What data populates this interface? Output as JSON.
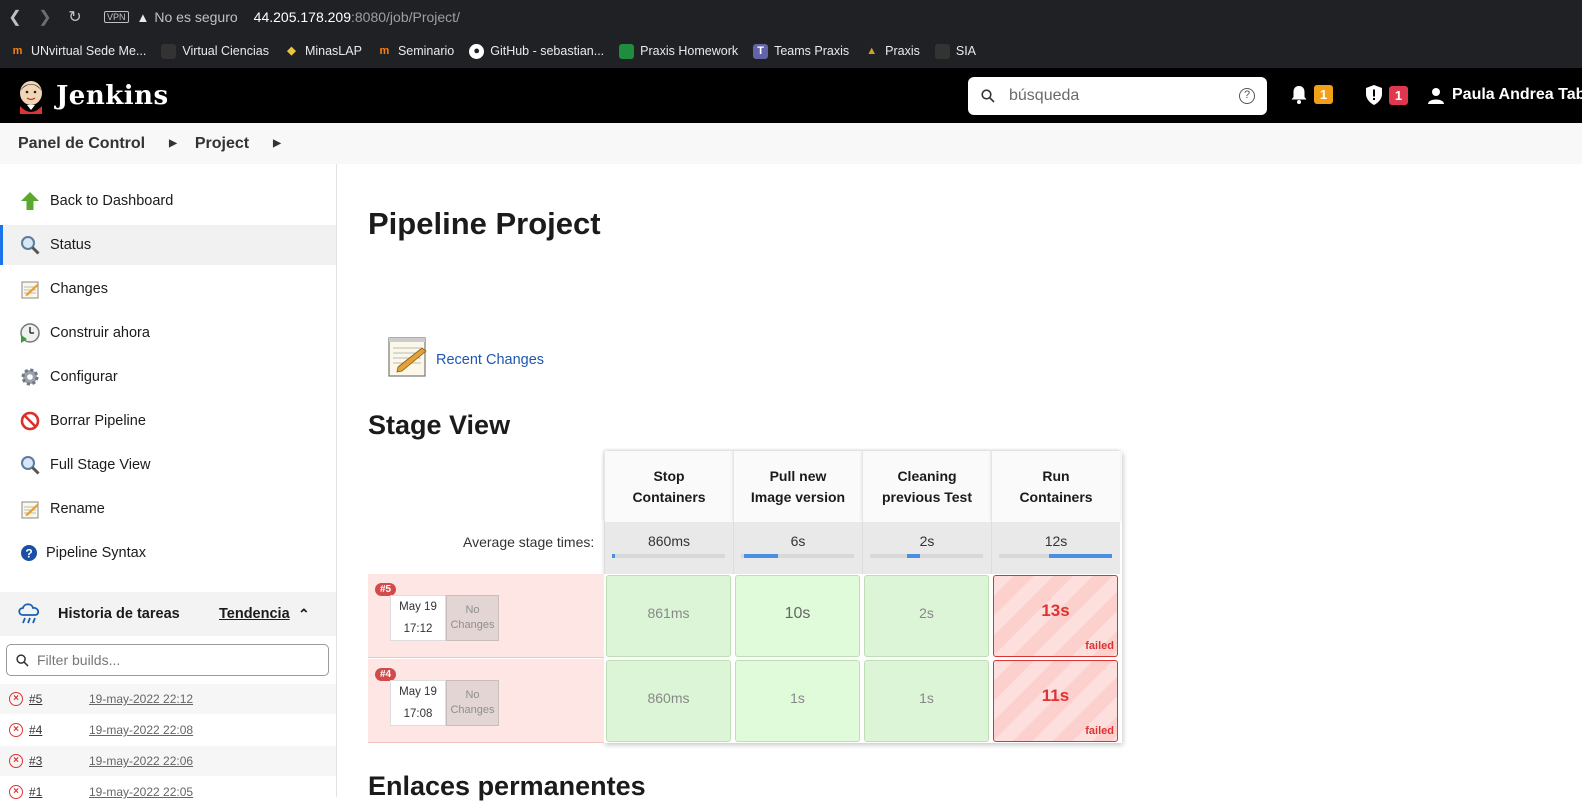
{
  "browser": {
    "vpn_label": "VPN",
    "security_text": "No es seguro",
    "url_host": "44.205.178.209",
    "url_rest": ":8080/job/Project/",
    "bookmarks": [
      {
        "label": "UNvirtual Sede Me...",
        "icon": "moodle-icon",
        "color": "#f98012"
      },
      {
        "label": "Virtual Ciencias",
        "icon": "page-icon",
        "color": "#333"
      },
      {
        "label": "MinasLAP",
        "icon": "minas-icon",
        "color": "#e8c547"
      },
      {
        "label": "Seminario",
        "icon": "moodle-icon",
        "color": "#f98012"
      },
      {
        "label": "GitHub - sebastian...",
        "icon": "github-icon",
        "color": "#fff"
      },
      {
        "label": "Praxis Homework",
        "icon": "classroom-icon",
        "color": "#1e8e3e"
      },
      {
        "label": "Teams Praxis",
        "icon": "teams-icon",
        "color": "#6264a7"
      },
      {
        "label": "Praxis",
        "icon": "praxis-icon",
        "color": "#c9a227"
      },
      {
        "label": "SIA",
        "icon": "page-icon",
        "color": "#333"
      }
    ]
  },
  "header": {
    "app_name": "Jenkins",
    "search_placeholder": "búsqueda",
    "notifications_count": "1",
    "security_count": "1",
    "user_name": "Paula Andrea Tab"
  },
  "breadcrumb": [
    "Panel de Control",
    "Project"
  ],
  "sidebar": {
    "items": [
      {
        "label": "Back to Dashboard",
        "icon": "arrow-up-icon"
      },
      {
        "label": "Status",
        "icon": "magnifier-icon"
      },
      {
        "label": "Changes",
        "icon": "notepad-icon"
      },
      {
        "label": "Construir ahora",
        "icon": "clock-play-icon"
      },
      {
        "label": "Configurar",
        "icon": "gear-icon"
      },
      {
        "label": "Borrar Pipeline",
        "icon": "no-entry-icon"
      },
      {
        "label": "Full Stage View",
        "icon": "magnifier-icon"
      },
      {
        "label": "Rename",
        "icon": "notepad-icon"
      },
      {
        "label": "Pipeline Syntax",
        "icon": "help-icon"
      }
    ],
    "history_title": "Historia de tareas",
    "trend_label": "Tendencia",
    "filter_placeholder": "Filter builds...",
    "builds": [
      {
        "num": "#5",
        "date": "19-may-2022 22:12"
      },
      {
        "num": "#4",
        "date": "19-may-2022 22:08"
      },
      {
        "num": "#3",
        "date": "19-may-2022 22:06"
      },
      {
        "num": "#1",
        "date": "19-may-2022 22:05"
      }
    ]
  },
  "main": {
    "title": "Pipeline Project",
    "recent_changes": "Recent Changes",
    "stage_view_title": "Stage View",
    "permalinks_title": "Enlaces permanentes",
    "avg_label": "Average stage times:",
    "stages": [
      {
        "name_line1": "Stop",
        "name_line2": "Containers",
        "avg": "860ms",
        "avg_fill_start": 0.0,
        "avg_fill_end": 0.03
      },
      {
        "name_line1": "Pull new",
        "name_line2": "Image version",
        "avg": "6s",
        "avg_fill_start": 0.03,
        "avg_fill_end": 0.33
      },
      {
        "name_line1": "Cleaning",
        "name_line2": "previous Test",
        "avg": "2s",
        "avg_fill_start": 0.33,
        "avg_fill_end": 0.44
      },
      {
        "name_line1": "Run",
        "name_line2": "Containers",
        "avg": "12s",
        "avg_fill_start": 0.44,
        "avg_fill_end": 1.0
      }
    ],
    "runs": [
      {
        "tag": "#5",
        "date": "May 19",
        "time": "17:12",
        "changes_line1": "No",
        "changes_line2": "Changes",
        "cells": [
          {
            "value": "861ms",
            "status": "ok"
          },
          {
            "value": "10s",
            "status": "ok"
          },
          {
            "value": "2s",
            "status": "ok"
          },
          {
            "value": "13s",
            "status": "failed",
            "status_label": "failed"
          }
        ]
      },
      {
        "tag": "#4",
        "date": "May 19",
        "time": "17:08",
        "changes_line1": "No",
        "changes_line2": "Changes",
        "cells": [
          {
            "value": "860ms",
            "status": "ok"
          },
          {
            "value": "1s",
            "status": "ok"
          },
          {
            "value": "1s",
            "status": "ok"
          },
          {
            "value": "11s",
            "status": "failed",
            "status_label": "failed"
          }
        ]
      }
    ]
  }
}
